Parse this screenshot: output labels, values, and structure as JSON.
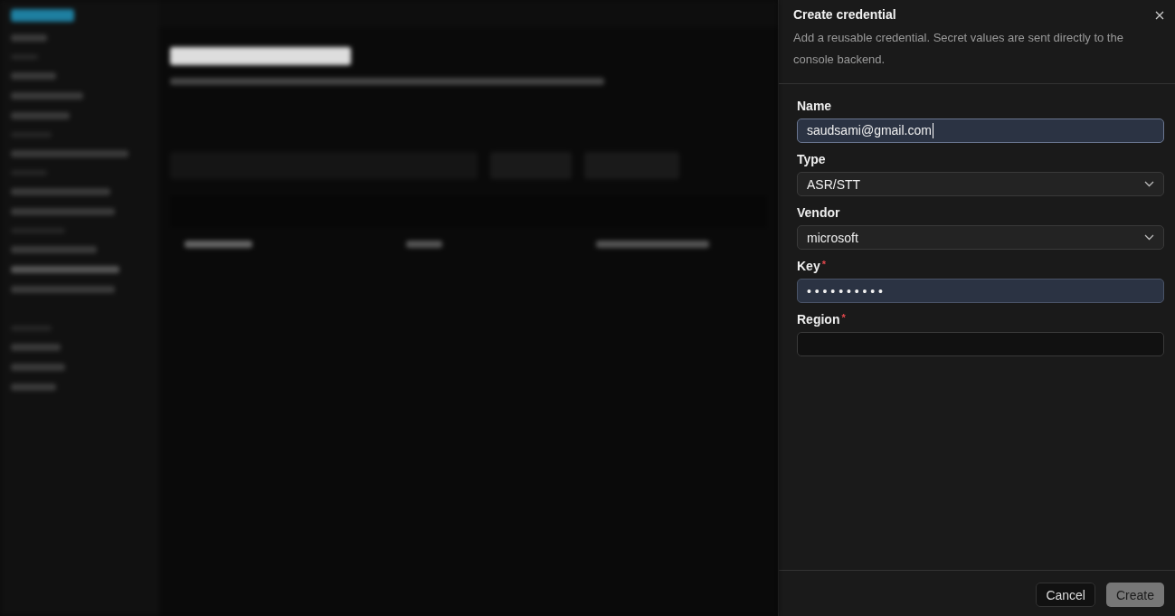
{
  "panel": {
    "title": "Create credential",
    "description": "Add a reusable credential. Secret values are sent directly to the console backend.",
    "fields": [
      {
        "kind": "text",
        "label": "Name",
        "value": "saudsami@gmail.com",
        "highlighted": true,
        "focused": true
      },
      {
        "kind": "select",
        "label": "Type",
        "value": "ASR/STT",
        "highlighted": false,
        "focused": false
      },
      {
        "kind": "select",
        "label": "Vendor",
        "value": "microsoft",
        "highlighted": false,
        "focused": false
      },
      {
        "kind": "text",
        "label": "Key",
        "required_mark": "*",
        "value": "• • • • • • • • • •",
        "highlighted": true,
        "focused": false
      },
      {
        "kind": "text",
        "label": "Region",
        "required_mark": "*",
        "highlighted": false,
        "focused": false
      }
    ],
    "buttons": [
      {
        "label": "Cancel",
        "kind": "secondary",
        "disabled": false
      },
      {
        "label": "Create",
        "kind": "primary",
        "disabled": true
      }
    ]
  }
}
